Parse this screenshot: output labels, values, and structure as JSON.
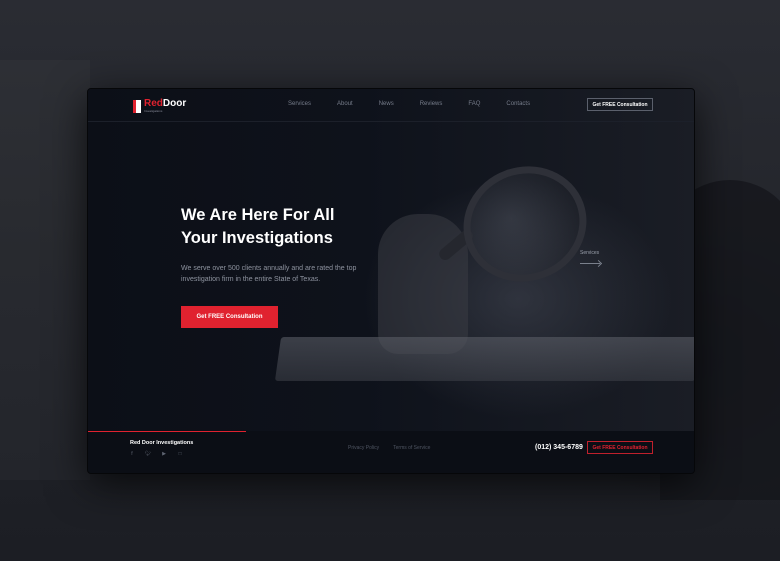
{
  "colors": {
    "accent": "#e0222f",
    "background": "#0d1119",
    "text_primary": "#ffffff",
    "text_muted": "#8e939f"
  },
  "header": {
    "logo_name_red": "Red",
    "logo_name_white": "Door",
    "logo_subtitle": "Investigations",
    "nav_items": [
      "Services",
      "About",
      "News",
      "Reviews",
      "FAQ",
      "Contacts"
    ],
    "cta_label": "Get FREE Consultation"
  },
  "hero": {
    "title_line1": "We Are Here For All",
    "title_line2": "Your Investigations",
    "description": "We serve over 500 clients annually and are rated the top investigation firm in the entire State of Texas.",
    "cta_label": "Get FREE Consultation",
    "side_label": "Services"
  },
  "footer": {
    "brand": "Red Door Investigations",
    "social_icons": [
      "facebook-icon",
      "twitter-icon",
      "youtube-icon",
      "instagram-icon"
    ],
    "links": [
      "Privacy Policy",
      "Terms of Service"
    ],
    "phone": "(012) 345-6789",
    "cta_label": "Get FREE Consultation"
  }
}
